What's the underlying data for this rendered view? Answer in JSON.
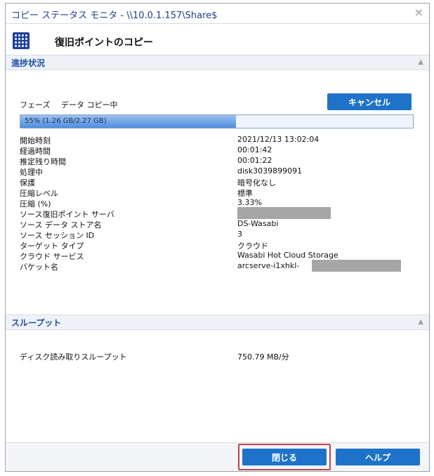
{
  "window": {
    "title": "コピー ステータス モニタ - \\\\10.0.1.157\\Share$",
    "close_glyph": "×"
  },
  "header": {
    "icon": "grid-icon",
    "heading": "復旧ポイントのコピー"
  },
  "progress_section": {
    "title": "進捗状況",
    "phase_label": "フェーズ",
    "phase_value": "データ コピー中",
    "cancel_label": "キャンセル",
    "progress_text": "55% (1.26 GB/2.27 GB)",
    "progress_fraction": 0.55
  },
  "properties": [
    {
      "key": "開始時刻",
      "value": "2021/12/13 13:02:04"
    },
    {
      "key": "経過時間",
      "value": "00:01:42"
    },
    {
      "key": "推定残り時間",
      "value": "00:01:22"
    },
    {
      "key": "処理中",
      "value": "disk3039899091"
    },
    {
      "key": "保護",
      "value": "暗号化なし"
    },
    {
      "key": "圧縮レベル",
      "value": "標準"
    },
    {
      "key": "圧縮 (%)",
      "value": "3.33%"
    },
    {
      "key": "ソース復旧ポイント サーバ",
      "value": ""
    },
    {
      "key": "ソース データ ストア名",
      "value": "DS-Wasabi"
    },
    {
      "key": "ソース セッション ID",
      "value": "3"
    },
    {
      "key": "ターゲット タイプ",
      "value": "クラウド"
    },
    {
      "key": "クラウド サービス",
      "value": "Wasabi Hot Cloud Storage"
    },
    {
      "key": "バケット名",
      "value": "arcserve-i1xhkl-"
    }
  ],
  "throughput_section": {
    "title": "スループット",
    "disk_read_label": "ディスク読み取りスループット",
    "disk_read_value": "750.79 MB/分"
  },
  "footer": {
    "close_label": "閉じる",
    "help_label": "ヘルプ"
  },
  "colors": {
    "accent": "#1e73c9",
    "title_text": "#1d3f8a",
    "focus_ring": "#c2444a"
  }
}
